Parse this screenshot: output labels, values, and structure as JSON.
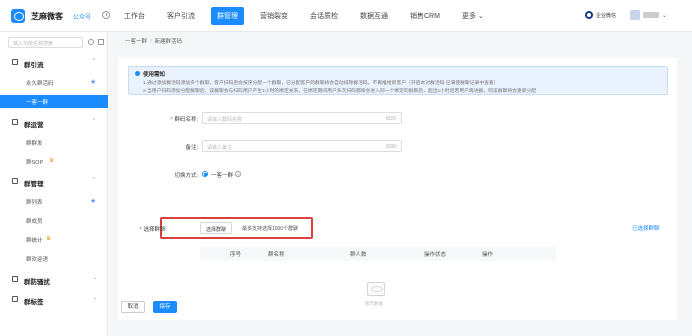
{
  "header": {
    "app_name": "芝麻微客",
    "account": "公众号",
    "nav": [
      "工作台",
      "客户引流",
      "群管理",
      "营销裂变",
      "会话质检",
      "数据互通",
      "销售CRM",
      "更多 ⌄"
    ],
    "active_nav": "群管理",
    "corp_name": "企业微信"
  },
  "sidebar": {
    "search_placeholder": "输入功能名称搜索",
    "groups": [
      {
        "label": "群引流",
        "items": [
          {
            "label": "永久群活码",
            "star": true
          },
          {
            "label": "一客一群",
            "active": true
          }
        ]
      },
      {
        "label": "群运营",
        "items": [
          {
            "label": "群群发"
          },
          {
            "label": "群SOP",
            "crown": true
          }
        ]
      },
      {
        "label": "群管理",
        "items": [
          {
            "label": "群列表",
            "star": true
          },
          {
            "label": "群成员"
          },
          {
            "label": "群统计",
            "crown": true
          },
          {
            "label": "群欢迎语"
          }
        ]
      },
      {
        "label": "群防骚扰",
        "items": []
      },
      {
        "label": "群标签",
        "items": []
      }
    ]
  },
  "main": {
    "breadcrumb": [
      "一客一群",
      "新建群活码"
    ],
    "notice": {
      "title": "使用需知",
      "lines": [
        "1.通过添加群活码添加多个群聊，客户扫码后会按序分配一个群聊，已分配客户的群聊将会自动排除群活码，不再推给新客户（开启本对群活码 已满使群聊记录中查看）",
        "2.当用户扫码添加分配群聊后，该群聊会与扫码用户产生1小时的绑定关系，在绑定期间用户多次扫码都将会进入同一个绑定的群聊后，超出1小时后若用户再进群，则该群聊将会重新分配"
      ]
    },
    "form": {
      "name_label": "群码名称:",
      "name_placeholder": "请输入群码名称",
      "name_counter": "0/20",
      "remark_label": "备注:",
      "remark_placeholder": "请输入备注",
      "remark_counter": "0/30",
      "mode_label": "切换方式:",
      "mode_value": "一客一群",
      "select_label": "选择群聊:",
      "select_button": "选择群聊",
      "select_tip": "最多支持选择1000个群聊",
      "selected_link": "已选择群聊"
    },
    "table": {
      "columns": [
        "序号",
        "群名称",
        "群人数",
        "操作状态",
        "操作"
      ],
      "empty_text": "暂无数据"
    }
  },
  "footer": {
    "cancel": "取消",
    "save": "保存"
  }
}
